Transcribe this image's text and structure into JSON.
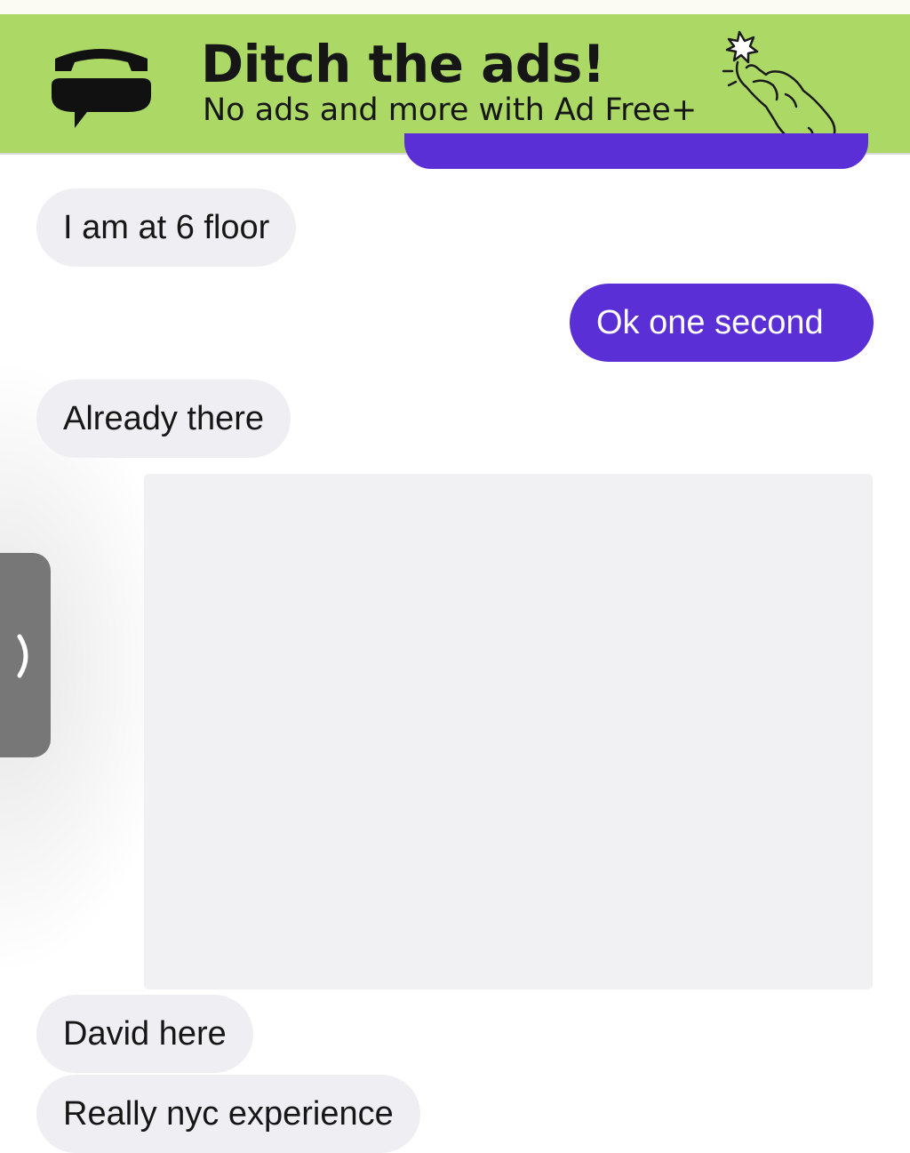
{
  "ad": {
    "title": "Ditch the ads!",
    "subtitle": "No ads and more with Ad Free+",
    "logo_icon": "textnow-logo-icon",
    "illustration_icon": "hand-snap-icon",
    "background_color": "#acd866"
  },
  "messages": [
    {
      "direction": "incoming",
      "text": "I am at 6 floor"
    },
    {
      "direction": "outgoing",
      "text": "Ok one second"
    },
    {
      "direction": "incoming",
      "text": "Already there"
    },
    {
      "direction": "outgoing",
      "type": "media"
    },
    {
      "direction": "incoming",
      "text": "David here"
    },
    {
      "direction": "incoming",
      "text": "Really nyc experience"
    }
  ],
  "side_tab": {
    "icon": "chevron-right-icon"
  },
  "colors": {
    "outgoing_bubble": "#5a2fd6",
    "incoming_bubble": "#efeff3",
    "side_tab": "#777777"
  }
}
